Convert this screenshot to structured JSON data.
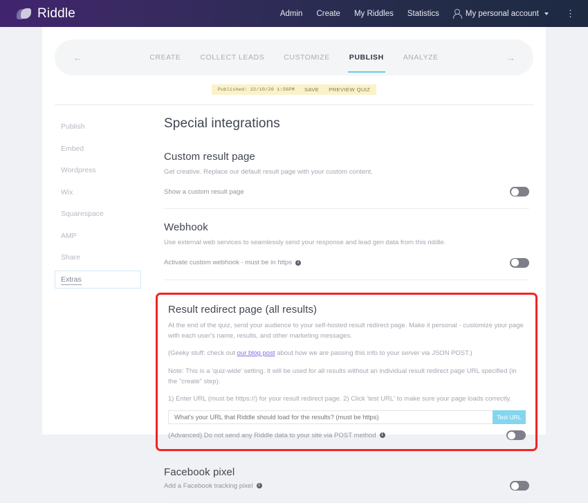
{
  "topnav": {
    "brand": "Riddle",
    "links": [
      {
        "label": "Admin"
      },
      {
        "label": "Create"
      },
      {
        "label": "My Riddles"
      },
      {
        "label": "Statistics"
      }
    ],
    "account_label": "My personal account",
    "kebab": "⋮"
  },
  "steps": {
    "back_arrow": "←",
    "forward_arrow": "→",
    "items": [
      {
        "label": "CREATE",
        "active": false
      },
      {
        "label": "COLLECT LEADS",
        "active": false
      },
      {
        "label": "CUSTOMIZE",
        "active": false
      },
      {
        "label": "PUBLISH",
        "active": true
      },
      {
        "label": "ANALYZE",
        "active": false
      }
    ]
  },
  "publish_bar": {
    "status": "Published: 22/10/20 1:56PM",
    "save": "SAVE",
    "preview": "PREVIEW QUIZ"
  },
  "sidebar": {
    "items": [
      {
        "label": "Publish",
        "active": false
      },
      {
        "label": "Embed",
        "active": false
      },
      {
        "label": "Wordpress",
        "active": false
      },
      {
        "label": "Wix",
        "active": false
      },
      {
        "label": "Squarespace",
        "active": false
      },
      {
        "label": "AMP",
        "active": false
      },
      {
        "label": "Share",
        "active": false
      },
      {
        "label": "Extras",
        "active": true
      }
    ]
  },
  "main": {
    "page_title": "Special integrations",
    "custom_result": {
      "title": "Custom result page",
      "desc": "Get creative. Replace our default result page with your custom content.",
      "toggle_label": "Show a custom result page",
      "toggle_on": false
    },
    "webhook": {
      "title": "Webhook",
      "desc": "Use external web services to seamlessly send your response and lead gen data from this riddle.",
      "toggle_label": "Activate custom webhook - must be in https",
      "toggle_on": false
    },
    "redirect": {
      "title": "Result redirect page (all results)",
      "para1": "At the end of the quiz, send your audience to your self-hosted result redirect page. Make it personal - customize your page with each user's name, results, and other marketing messages.",
      "para2_pre": "(Geeky stuff: check out ",
      "para2_link": "our blog post",
      "para2_post": " about how we are passing this info to your server via JSON POST.)",
      "para3": "Note: This is a 'quiz-wide' setting. It will be used for all results without an individual result redirect page URL specified (in the \"create\" step).",
      "para4": "1) Enter URL (must be https://) for your result redirect page. 2) Click 'test URL' to make sure your page loads correctly.",
      "url_value": "",
      "url_placeholder": "What's your URL that Riddle should load for the results? (must be https)",
      "test_button": "Test URL",
      "advanced_label": "(Advanced) Do not send any Riddle data to your site via POST method",
      "advanced_toggle_on": false,
      "highlight_color": "#f0241f"
    },
    "facebook": {
      "title": "Facebook pixel",
      "toggle_label": "Add a Facebook tracking pixel",
      "toggle_on": false
    }
  },
  "colors": {
    "accent_teal": "#62d0e8",
    "brand_purple": "#41246e",
    "link_purple": "#7b6fe0",
    "highlight_red": "#f0241f",
    "test_button": "#84d6ee",
    "publish_bar_bg": "#faf2c8"
  }
}
